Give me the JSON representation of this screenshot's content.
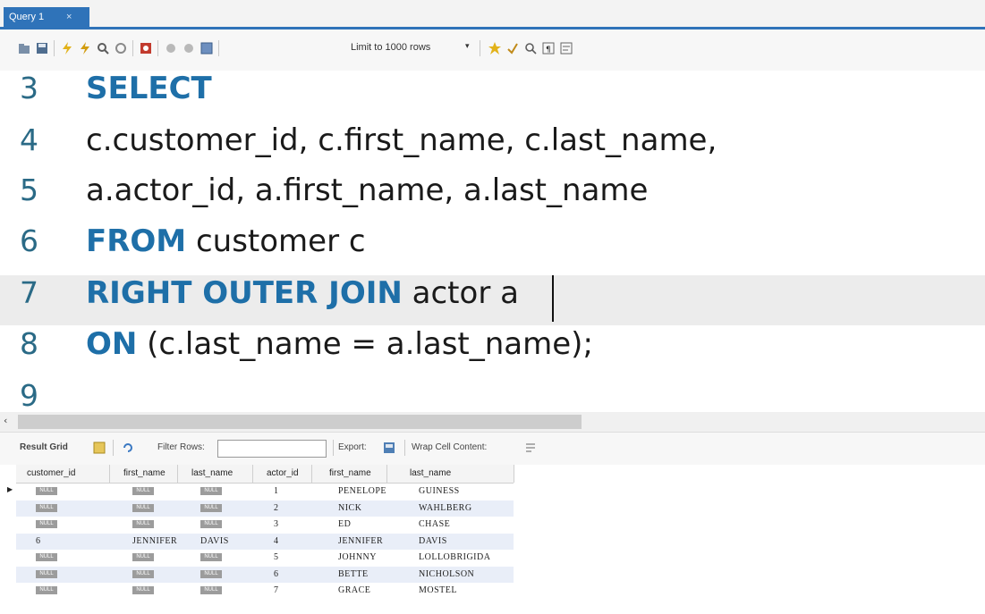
{
  "tab": {
    "title": "Query 1",
    "close": "×"
  },
  "toolbar": {
    "limit_label": "Limit to 1000 rows"
  },
  "editor": {
    "lines": [
      {
        "num": "3",
        "parts": [
          {
            "kw": "SELECT"
          }
        ]
      },
      {
        "num": "4",
        "parts": [
          {
            "t": "c.customer_id, c.first_name, c.last_name,"
          }
        ]
      },
      {
        "num": "5",
        "parts": [
          {
            "t": "a.actor_id, a.first_name, a.last_name"
          }
        ]
      },
      {
        "num": "6",
        "parts": [
          {
            "kw": "FROM"
          },
          {
            "t": " customer c"
          }
        ]
      },
      {
        "num": "7",
        "parts": [
          {
            "kw": "RIGHT OUTER JOIN"
          },
          {
            "t": " actor a"
          }
        ]
      },
      {
        "num": "8",
        "parts": [
          {
            "kw": "ON"
          },
          {
            "t": " (c.last_name = a.last_name);"
          }
        ]
      },
      {
        "num": "9",
        "parts": []
      }
    ]
  },
  "results": {
    "result_grid_label": "Result Grid",
    "filter_label": "Filter Rows:",
    "export_label": "Export:",
    "wrap_label": "Wrap Cell Content:",
    "null_label": "NULL",
    "columns": [
      "customer_id",
      "first_name",
      "last_name",
      "actor_id",
      "first_name",
      "last_name"
    ],
    "rows": [
      [
        null,
        null,
        null,
        "1",
        "PENELOPE",
        "GUINESS"
      ],
      [
        null,
        null,
        null,
        "2",
        "NICK",
        "WAHLBERG"
      ],
      [
        null,
        null,
        null,
        "3",
        "ED",
        "CHASE"
      ],
      [
        "6",
        "JENNIFER",
        "DAVIS",
        "4",
        "JENNIFER",
        "DAVIS"
      ],
      [
        null,
        null,
        null,
        "5",
        "JOHNNY",
        "LOLLOBRIGIDA"
      ],
      [
        null,
        null,
        null,
        "6",
        "BETTE",
        "NICHOLSON"
      ],
      [
        null,
        null,
        null,
        "7",
        "GRACE",
        "MOSTEL"
      ]
    ]
  },
  "colors": {
    "keyword": "#1e6fa8",
    "accent": "#2f73b9"
  }
}
